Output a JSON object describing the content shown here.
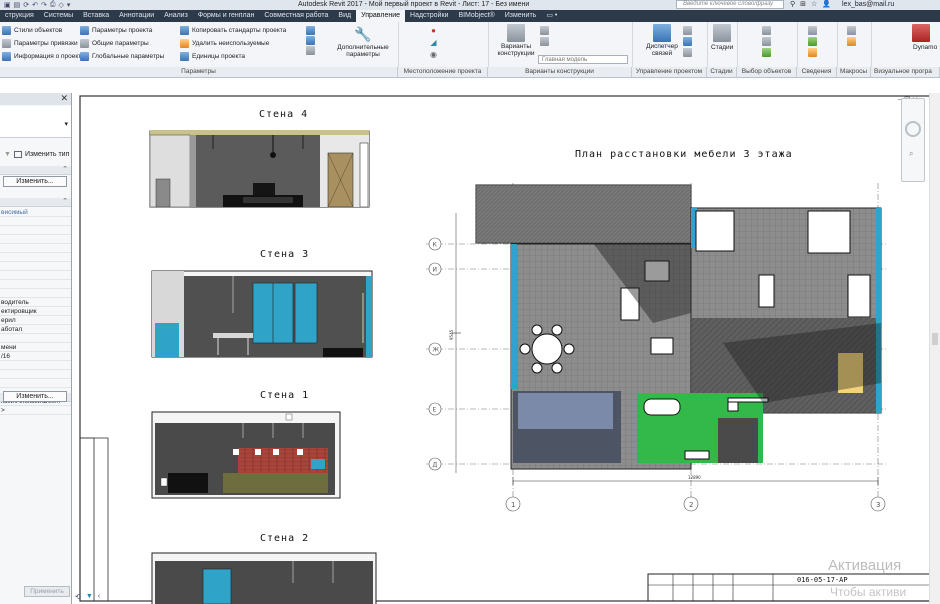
{
  "titlebar": {
    "title": "Autodesk Revit 2017 -     Мой первый проект в Revit - Лист: 17 - Без имени",
    "search_placeholder": "Введите ключевое слово/фразу",
    "user": "lex_bas@mail.ru",
    "qat_icons": [
      "open-icon",
      "save-icon",
      "sync-icon",
      "undo-icon",
      "redo-icon",
      "print-icon"
    ]
  },
  "tabs": [
    "струкция",
    "Системы",
    "Вставка",
    "Аннотации",
    "Анализ",
    "Формы и генплан",
    "Совместная работа",
    "Вид",
    "Управление",
    "Надстройки",
    "BIMobject®",
    "Изменить",
    "▭ •"
  ],
  "active_tab": "Управление",
  "ribbon": {
    "parameters": {
      "col1": [
        "Стили объектов",
        "Параметры привязки",
        "Информация о проекте"
      ],
      "col2": [
        "Параметры проекта",
        "Общие параметры",
        "Глобальные параметры"
      ],
      "col3": [
        "Копировать стандарты проекта",
        "Удалить неиспользуемые",
        "Единицы проекта"
      ],
      "additional": "Дополнительные параметры",
      "label": "Параметры"
    },
    "location": {
      "label": "Местоположение проекта"
    },
    "design_options": {
      "button": "Варианты конструкции",
      "main_model": "Главная модель",
      "label": "Варианты конструкции"
    },
    "project_management": {
      "manager": "Диспетчер связей",
      "label": "Управление проектом"
    },
    "phases": {
      "label": "Стадии",
      "button": "Стадии"
    },
    "selection": {
      "label": "Выбор объектов"
    },
    "inquiry": {
      "label": "Сведения"
    },
    "macros": {
      "label": "Макросы"
    },
    "visual_programming": {
      "label": "Визуальное програ",
      "dynamo": "Dynamo"
    }
  },
  "properties": {
    "change_type": "Изменить тип",
    "edit_button_1": "Изменить...",
    "edit_button_2": "Изменить...",
    "apply": "Применить",
    "rows": [
      "висимый",
      "",
      "",
      "",
      "",
      "",
      "",
      "",
      "",
      "",
      "водитель",
      "ектировщик",
      "ерил",
      "аботал",
      "",
      "мени",
      "/16",
      "",
      "",
      "",
      "",
      "ксей\\Алексей\\Des...",
      ">"
    ]
  },
  "sheet": {
    "wall4": "Стена 4",
    "wall3": "Стена 3",
    "wall1": "Стена 1",
    "wall2": "Стена 2",
    "plan_title": "План расстановки мебели 3 этажа",
    "sheet_number": "016-05-17-АР",
    "grid_letters": [
      "К",
      "И",
      "Ж",
      "Е",
      "Д"
    ],
    "grid_numbers": [
      "1",
      "2",
      "3"
    ]
  },
  "watermark": {
    "line1": "Активация",
    "line2": "Чтобы активи"
  },
  "colors": {
    "tab_bg": "#2d3a49",
    "ribbon_bg": "#f3f5f8",
    "wall_blue": "#2fa3c8",
    "bathroom_green": "#33b84a",
    "kitchen_brick": "#a8443a"
  }
}
